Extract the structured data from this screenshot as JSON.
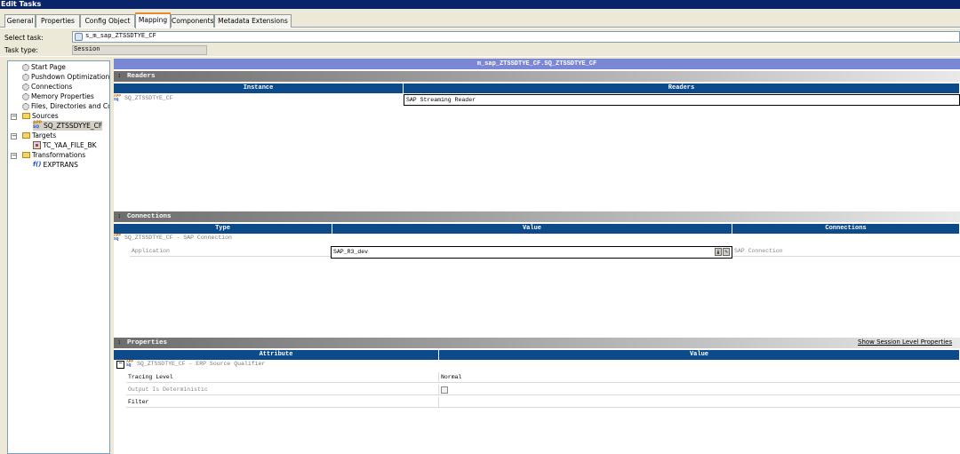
{
  "window": {
    "title": "Edit Tasks"
  },
  "tabs": [
    {
      "label": "General"
    },
    {
      "label": "Properties"
    },
    {
      "label": "Config Object"
    },
    {
      "label": "Mapping"
    },
    {
      "label": "Components"
    },
    {
      "label": "Metadata Extensions"
    }
  ],
  "active_tab": "Mapping",
  "header": {
    "select_task_label": "Select task:",
    "select_task_value": "s_m_sap_ZTSSDTYE_CF",
    "task_type_label": "Task type:",
    "task_type_value": "Session"
  },
  "tree": {
    "items": [
      {
        "label": "Start Page"
      },
      {
        "label": "Pushdown Optimization"
      },
      {
        "label": "Connections"
      },
      {
        "label": "Memory Properties"
      },
      {
        "label": "Files, Directories and Commands"
      },
      {
        "label": "Sources"
      },
      {
        "label": "SQ_ZTSSDYYE_CF"
      },
      {
        "label": "Targets"
      },
      {
        "label": "TC_YAA_FILE_BK"
      },
      {
        "label": "Transformations"
      },
      {
        "label": "EXPTRANS"
      }
    ],
    "icon_text": {
      "app": "APP",
      "sq": "SQ",
      "fx": "f()"
    }
  },
  "mapping_title": "m_sap_ZTSSDTYE_CF.SQ_ZTSSDTYE_CF",
  "readers": {
    "section_label": "Readers",
    "columns": [
      "Instance",
      "Readers"
    ],
    "rows": [
      {
        "instance": "SQ_ZTSSDTYE_CF",
        "reader": "SAP Streaming Reader"
      }
    ]
  },
  "connections": {
    "section_label": "Connections",
    "columns": [
      "Type",
      "Value",
      "Connections"
    ],
    "group": "SQ_ZTSSDTYE_CF - SAP Connection",
    "rows": [
      {
        "type": "Application",
        "value": "SAP_R3_dev",
        "connection": "SAP Connection"
      }
    ]
  },
  "properties": {
    "section_label": "Properties",
    "show_session_link": "Show Session Level Properties",
    "columns": [
      "Attribute",
      "Value"
    ],
    "group": "SQ_ZTSSDTYE_CF - ERP Source Qualifier",
    "rows": [
      {
        "attribute": "Tracing Level",
        "value": "Normal"
      },
      {
        "attribute": "Output Is Deterministic",
        "value": ""
      },
      {
        "attribute": "Filter",
        "value": ""
      }
    ],
    "output_deterministic_checked": false
  },
  "colors": {
    "titlebar": "#0a246a",
    "column_header": "#0d4a8a",
    "mapping_title_bar": "#7b86d4",
    "window_background": "#ece9d8"
  }
}
